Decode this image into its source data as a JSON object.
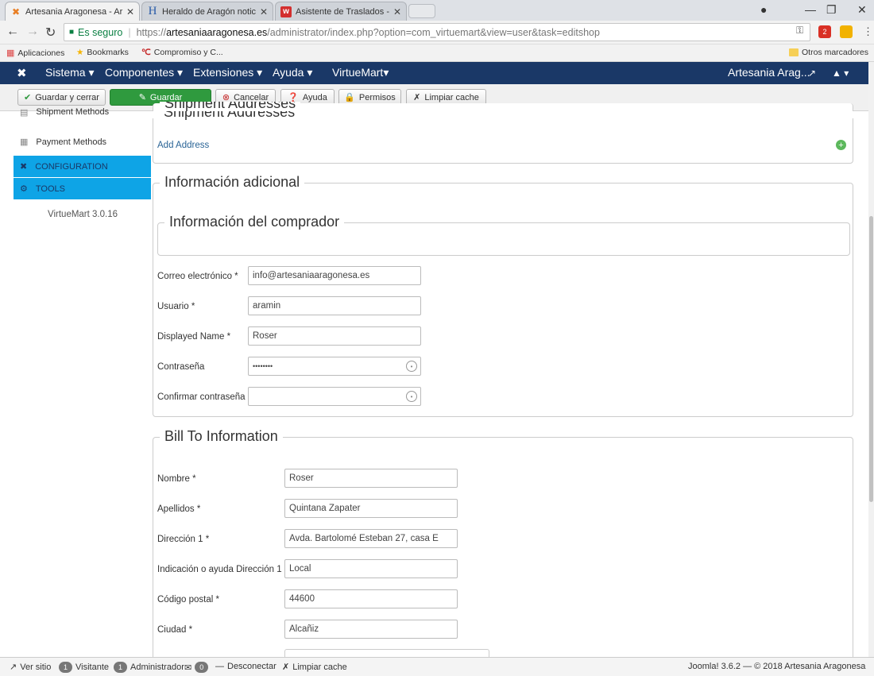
{
  "browser": {
    "tabs": [
      {
        "title": "Artesania Aragonesa - Ar",
        "active": true
      },
      {
        "title": "Heraldo de Aragón notic",
        "active": false
      },
      {
        "title": "Asistente de Traslados - ",
        "active": false
      }
    ],
    "secure_label": "Es seguro",
    "url_scheme": "https://",
    "url_host": "artesaniaaragonesa.es",
    "url_path": "/administrator/index.php?option=com_virtuemart&view=user&task=editshop",
    "extension_badge": "2"
  },
  "bookmarks": {
    "apps": "Aplicaciones",
    "items": [
      "Bookmarks",
      "Compromiso y C..."
    ],
    "other": "Otros marcadores"
  },
  "nav": {
    "menus": [
      "Sistema ▾",
      "Componentes ▾",
      "Extensiones ▾",
      "Ayuda ▾",
      "VirtueMart▾"
    ],
    "site_name": "Artesania Arag..."
  },
  "toolbar": {
    "save_close": "Guardar y cerrar",
    "save": "Guardar",
    "cancel": "Cancelar",
    "help": "Ayuda",
    "permissions": "Permisos",
    "clear_cache": "Limpiar cache"
  },
  "sidebar": {
    "items": [
      {
        "label": "Shipment Methods"
      },
      {
        "label": "Payment Methods"
      },
      {
        "label": "CONFIGURATION"
      },
      {
        "label": "TOOLS"
      }
    ],
    "version": "VirtueMart 3.0.16"
  },
  "shipment": {
    "legend": "Shipment Addresses",
    "add_address": "Add Address"
  },
  "additional": {
    "legend": "Información adicional",
    "buyer_legend": "Información del comprador",
    "fields": [
      {
        "label": "Correo electrónico *",
        "value": "info@artesaniaaragonesa.es"
      },
      {
        "label": "Usuario *",
        "value": "aramin"
      },
      {
        "label": "Displayed Name *",
        "value": "Roser"
      },
      {
        "label": "Contraseña",
        "value": "••••••••"
      },
      {
        "label": "Confirmar contraseña",
        "value": ""
      }
    ]
  },
  "billto": {
    "legend": "Bill To Information",
    "fields": [
      {
        "label": "Nombre *",
        "value": "Roser"
      },
      {
        "label": "Apellidos *",
        "value": "Quintana Zapater"
      },
      {
        "label": "Dirección 1 *",
        "value": "Avda. Bartolomé Esteban 27, casa E"
      },
      {
        "label": "Indicación o ayuda Dirección 1",
        "value": "Local"
      },
      {
        "label": "Código postal *",
        "value": "44600"
      },
      {
        "label": "Ciudad *",
        "value": "Alcañiz"
      }
    ]
  },
  "status": {
    "view_site": "Ver sitio",
    "visitors_count": "1",
    "visitors_label": "Visitante",
    "admins_count": "1",
    "admins_label": "Administrador",
    "messages_count": "0",
    "logout": "Desconectar",
    "clear_cache": "Limpiar cache",
    "footer": "Joomla! 3.6.2 — © 2018 Artesania Aragonesa"
  }
}
